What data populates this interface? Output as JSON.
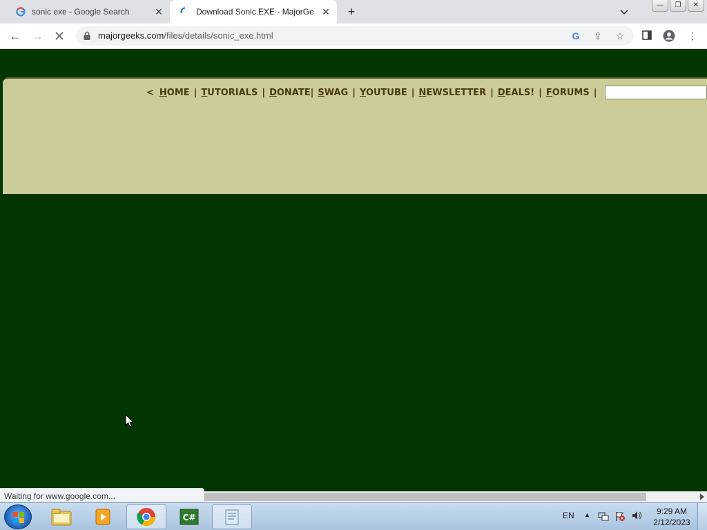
{
  "browser": {
    "tabs": [
      {
        "title": "sonic exe - Google Search",
        "active": false,
        "icon": "google-icon"
      },
      {
        "title": "Download Sonic.EXE - MajorGeeks",
        "active": true,
        "icon": "loading-spinner-icon"
      }
    ],
    "new_tab_label": "+",
    "address": {
      "host": "majorgeeks.com",
      "path": "/files/details/sonic_exe.html"
    },
    "status_text": "Waiting for www.google.com...",
    "window_buttons": {
      "minimize": "—",
      "restore": "❐",
      "close": "✕"
    }
  },
  "site": {
    "nav": {
      "open": "<",
      "close": ">",
      "items": [
        {
          "key": "H",
          "rest": "OME"
        },
        {
          "key": "T",
          "rest": "UTORIALS"
        },
        {
          "key": "D",
          "rest": "ONATE"
        },
        {
          "key": "S",
          "rest": "WAG"
        },
        {
          "key": "Y",
          "rest": "OUTUBE"
        },
        {
          "key": "N",
          "rest": "EWSLETTER"
        },
        {
          "key": "D",
          "rest": "EALS!"
        },
        {
          "key": "F",
          "rest": "ORUMS"
        }
      ],
      "search_value": ""
    },
    "colors": {
      "background": "#023600",
      "banner": "#cccc99",
      "nav_text": "#4a3c0a"
    }
  },
  "taskbar": {
    "language": "EN",
    "time": "9:29 AM",
    "date": "2/12/2023",
    "apps": [
      "file-explorer-icon",
      "media-player-icon",
      "chrome-icon",
      "csharp-app-icon",
      "notepad-icon"
    ]
  }
}
